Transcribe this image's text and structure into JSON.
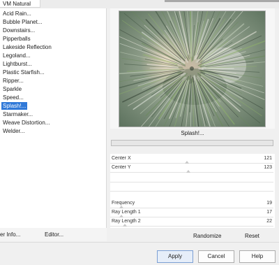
{
  "category_tab": "VM Natural",
  "filters": [
    "Acid Rain...",
    "Bubble Planet...",
    "Downstairs...",
    "Pipperballs",
    "Lakeside Reflection",
    "Legoland...",
    "Lightburst...",
    "Plastic Starfish...",
    "Ripper...",
    "Sparkle",
    "Speed...",
    "Splash!...",
    "Starmaker...",
    "Weave Distortion...",
    "Welder..."
  ],
  "selected_filter_index": 11,
  "left_buttons": {
    "info": "er Info...",
    "editor": "Editor..."
  },
  "preview": {
    "caption": "Splash!...",
    "progress_fraction": 0.0
  },
  "params": [
    {
      "label": "Center X",
      "value": "121",
      "slider_fraction": 0.47
    },
    {
      "label": "Center Y",
      "value": "123",
      "slider_fraction": 0.48
    },
    {
      "label": "Frequency",
      "value": "19",
      "slider_fraction": 0.07
    },
    {
      "label": "Ray Length 1",
      "value": "17",
      "slider_fraction": 0.07
    },
    {
      "label": "Ray Length 2",
      "value": "22",
      "slider_fraction": 0.09
    }
  ],
  "param_buttons": {
    "randomize": "Randomize",
    "reset": "Reset"
  },
  "dialog_buttons": {
    "apply": "Apply",
    "cancel": "Cancel",
    "help": "Help"
  },
  "colors": {
    "selection": "#3079d8",
    "preview_bg": "#8e9f8b",
    "apply_border": "#7b9fd4"
  }
}
